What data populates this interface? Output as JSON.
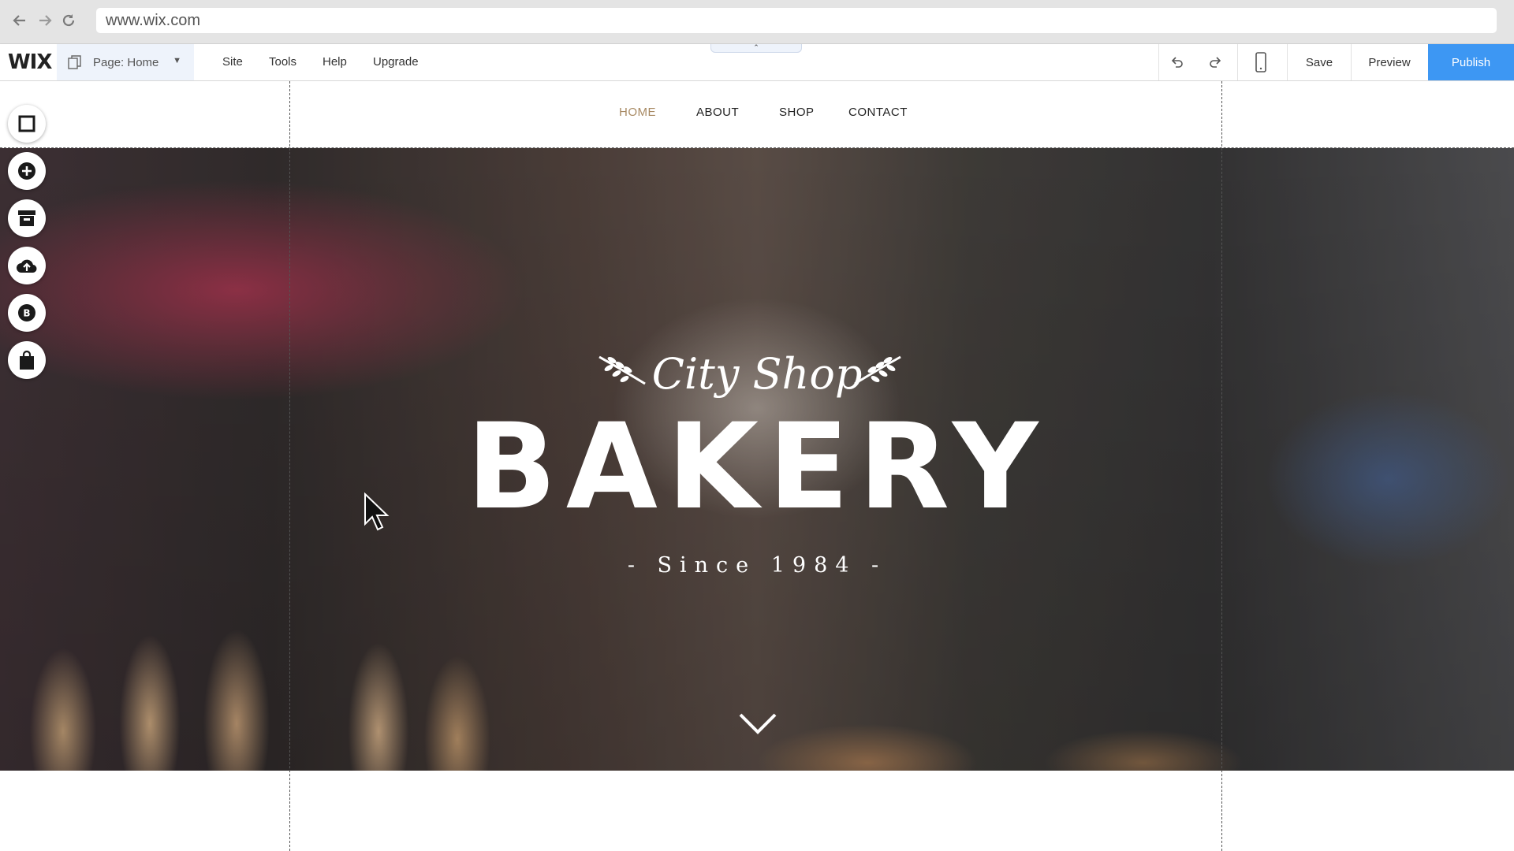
{
  "browser": {
    "url": "www.wix.com",
    "icons": [
      "back-arrow-icon",
      "forward-arrow-icon",
      "reload-icon"
    ]
  },
  "editor": {
    "logo": "WIX",
    "page_selector": "Page: Home",
    "menu": [
      "Site",
      "Tools",
      "Help",
      "Upgrade"
    ],
    "collapse_glyph": "⌃",
    "save_label": "Save",
    "preview_label": "Preview",
    "publish_label": "Publish",
    "accent_color": "#3d97f3",
    "tool_icons": [
      "undo-icon",
      "redo-icon",
      "mobile-view-icon"
    ]
  },
  "left_toolbar": {
    "tools": [
      "background-icon",
      "add-icon",
      "app-market-icon",
      "upload-icon",
      "blog-icon",
      "store-icon"
    ]
  },
  "site": {
    "nav": [
      "HOME",
      "ABOUT",
      "SHOP",
      "CONTACT"
    ],
    "active_nav": "HOME",
    "active_color": "#a88a63"
  },
  "hero": {
    "subtitle": "City Shop",
    "title": "BAKERY",
    "since": "- Since 1984 -"
  }
}
